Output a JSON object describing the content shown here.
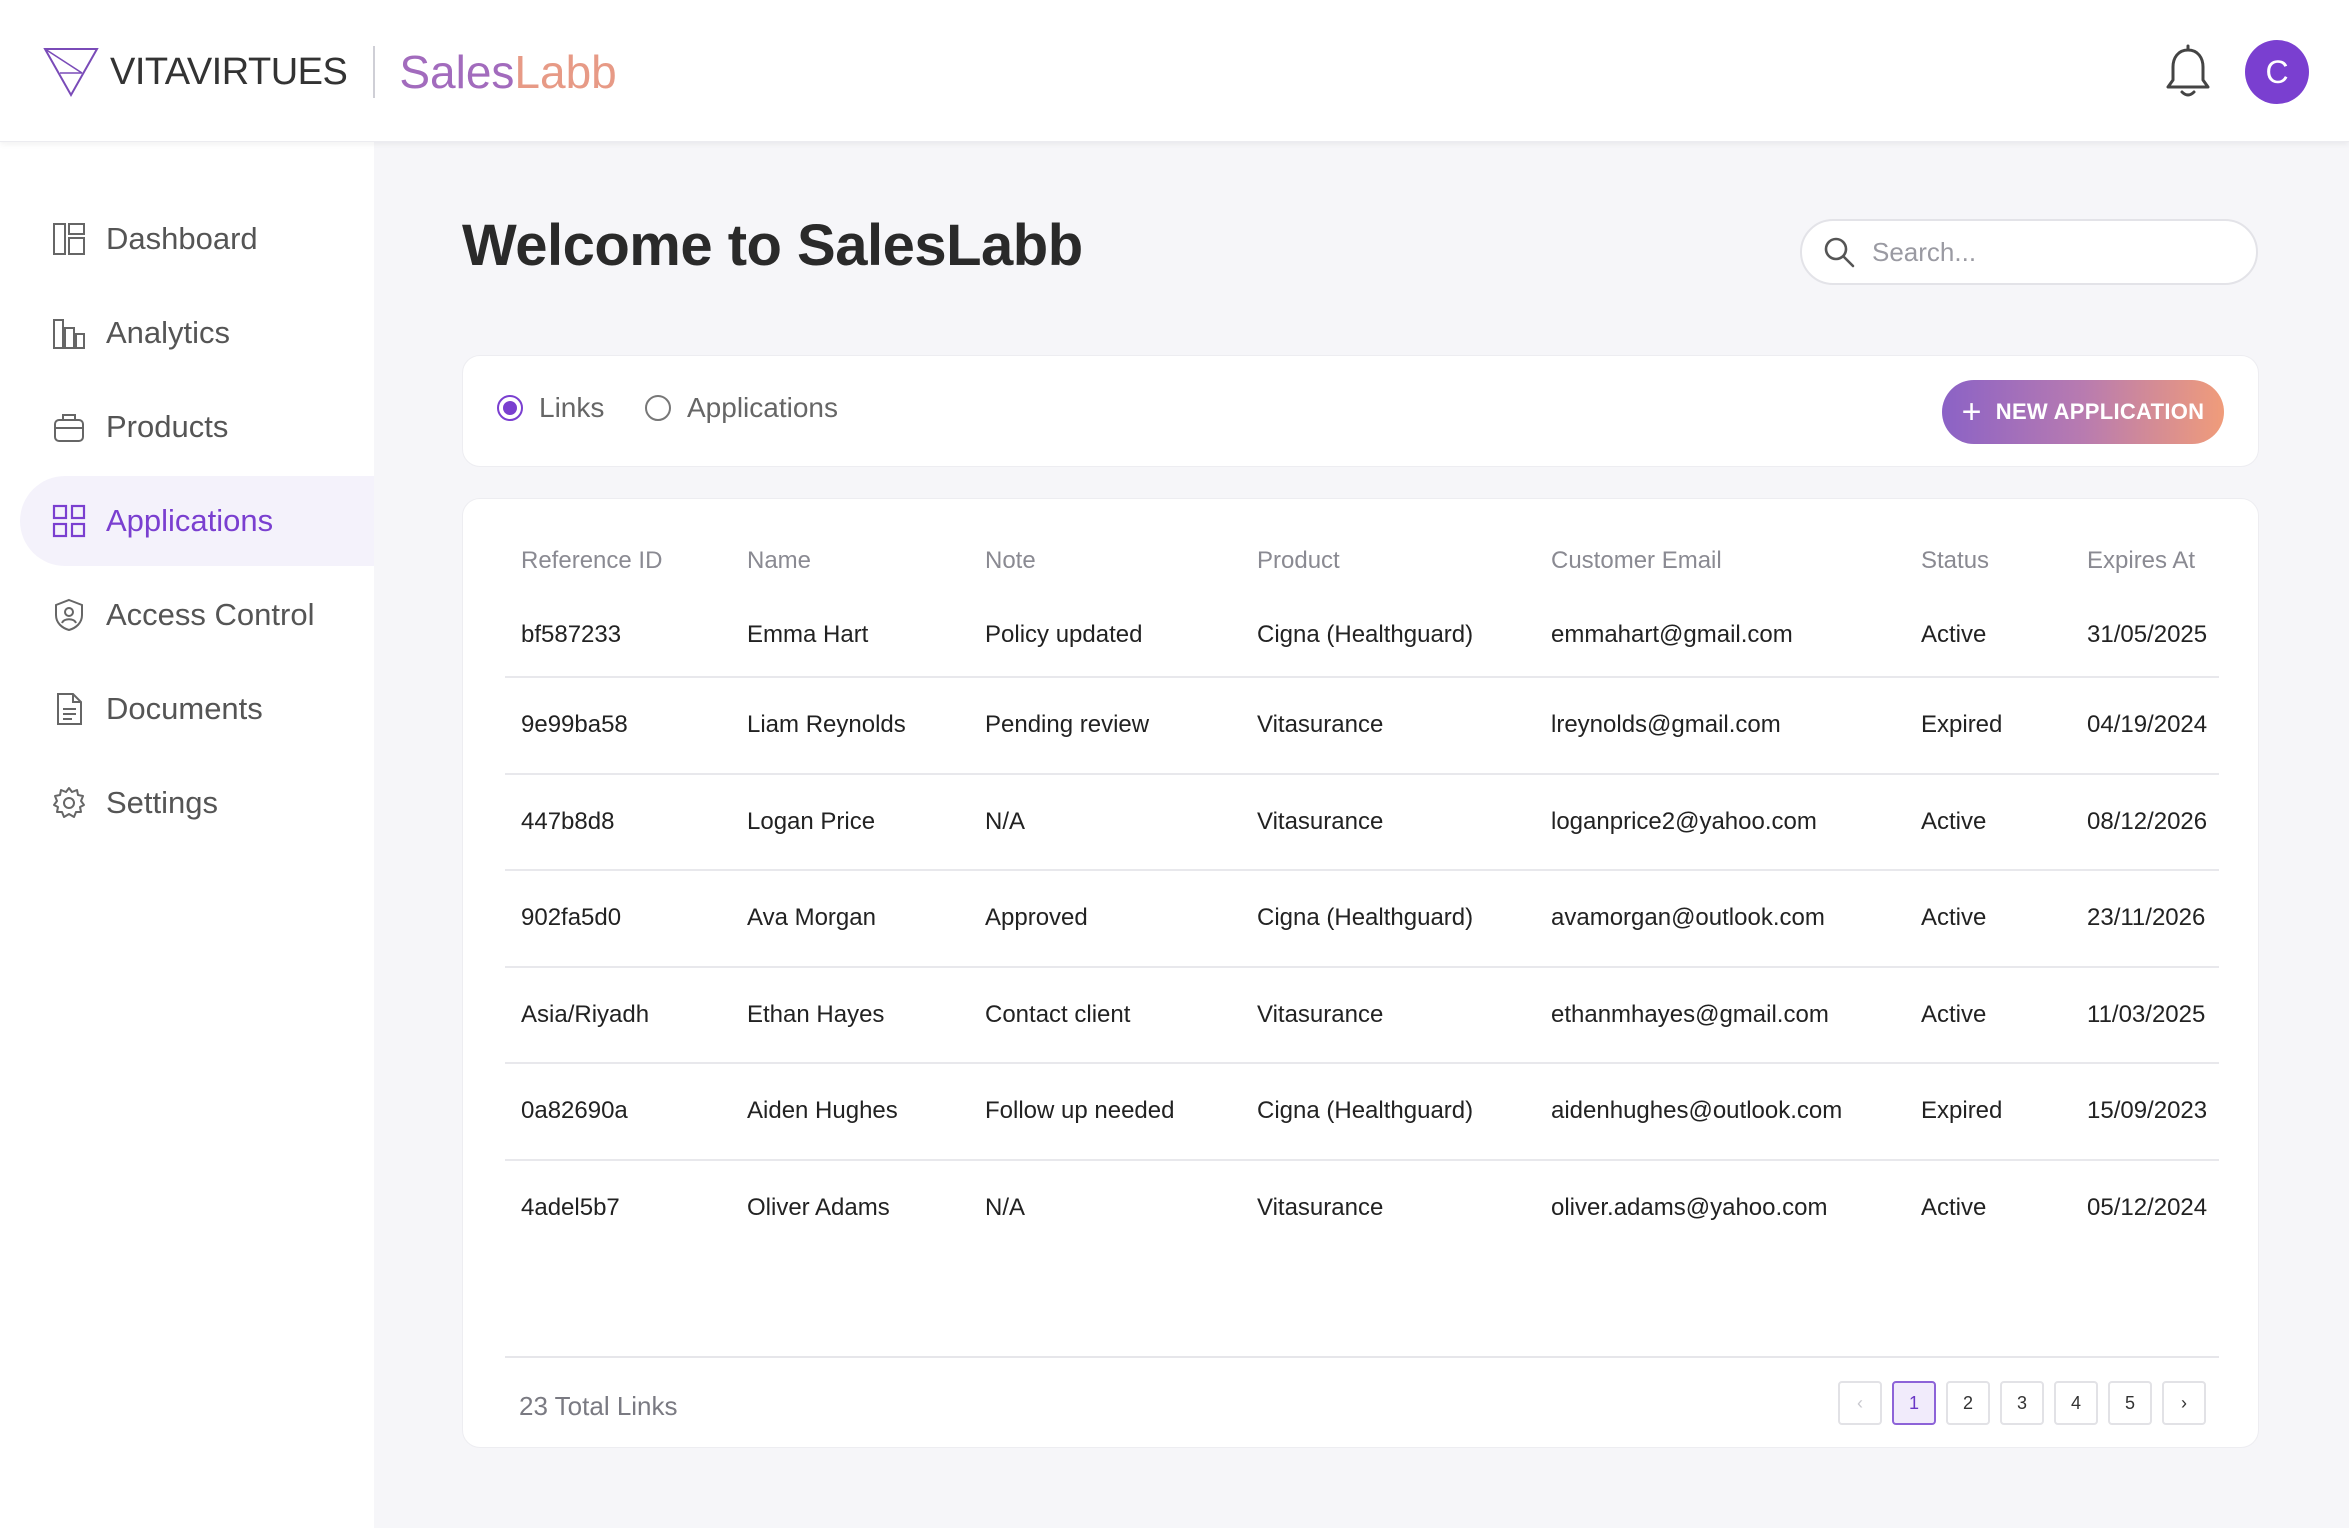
{
  "header": {
    "brand_vita": "VITAVIRTUES",
    "brand_sales_part1": "Sales",
    "brand_sales_part2": "Labb",
    "avatar_initial": "C"
  },
  "sidebar": {
    "items": [
      {
        "label": "Dashboard",
        "icon": "dashboard-icon"
      },
      {
        "label": "Analytics",
        "icon": "bar-chart-icon"
      },
      {
        "label": "Products",
        "icon": "box-icon"
      },
      {
        "label": "Applications",
        "icon": "grid-icon",
        "active": true
      },
      {
        "label": "Access Control",
        "icon": "shield-icon"
      },
      {
        "label": "Documents",
        "icon": "document-icon"
      },
      {
        "label": "Settings",
        "icon": "gear-icon"
      }
    ]
  },
  "main": {
    "title": "Welcome to SalesLabb",
    "search_placeholder": "Search...",
    "filters": {
      "links_label": "Links",
      "applications_label": "Applications",
      "selected": "Links"
    },
    "new_button_label": "NEW APPLICATION",
    "table": {
      "columns": [
        "Reference ID",
        "Name",
        "Note",
        "Product",
        "Customer Email",
        "Status",
        "Expires At"
      ],
      "rows": [
        [
          "bf587233",
          "Emma Hart",
          "Policy updated",
          "Cigna (Healthguard)",
          "emmahart@gmail.com",
          "Active",
          "31/05/2025"
        ],
        [
          "9e99ba58",
          "Liam Reynolds",
          "Pending review",
          "Vitasurance",
          "lreynolds@gmail.com",
          "Expired",
          "04/19/2024"
        ],
        [
          "447b8d8",
          "Logan Price",
          "N/A",
          "Vitasurance",
          "loganprice2@yahoo.com",
          "Active",
          "08/12/2026"
        ],
        [
          "902fa5d0",
          "Ava Morgan",
          "Approved",
          "Cigna (Healthguard)",
          "avamorgan@outlook.com",
          "Active",
          "23/11/2026"
        ],
        [
          "Asia/Riyadh",
          "Ethan Hayes",
          "Contact client",
          "Vitasurance",
          "ethanmhayes@gmail.com",
          "Active",
          "11/03/2025"
        ],
        [
          "0a82690a",
          "Aiden Hughes",
          "Follow up needed",
          "Cigna (Healthguard)",
          "aidenhughes@outlook.com",
          "Expired",
          "15/09/2023"
        ],
        [
          "4adel5b7",
          "Oliver Adams",
          "N/A",
          "Vitasurance",
          "oliver.adams@yahoo.com",
          "Active",
          "05/12/2024"
        ]
      ]
    },
    "footer": {
      "total_label": "23 Total Links",
      "pages": [
        "1",
        "2",
        "3",
        "4",
        "5"
      ],
      "current_page": "1",
      "prev_glyph": "‹",
      "next_glyph": "›"
    }
  },
  "colors": {
    "accent": "#7a3fd0",
    "gradient_start": "#8b62c6",
    "gradient_end": "#f09c7a",
    "brand_sales": "#a26bbd",
    "brand_labb": "#e79a86"
  }
}
